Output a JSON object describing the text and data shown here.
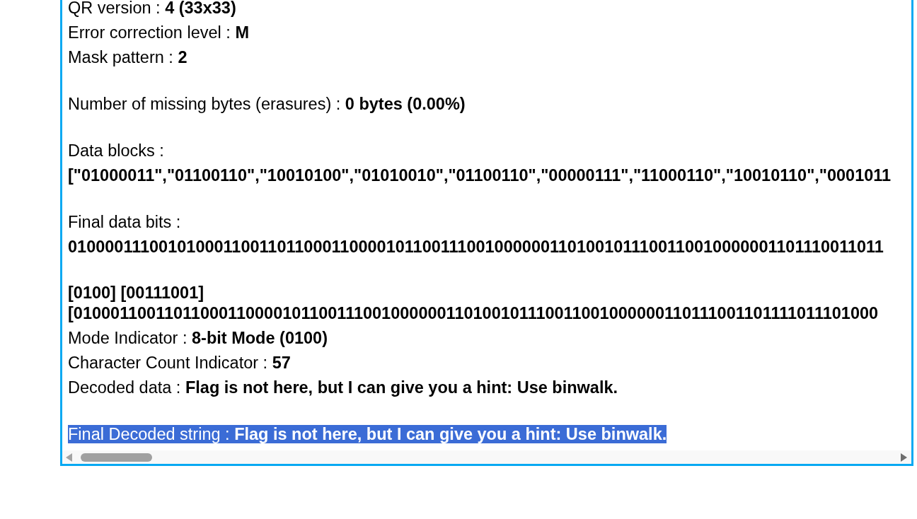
{
  "output_panel": {
    "sections": [
      {
        "lines": [
          {
            "kind": "field",
            "label": "QR version :",
            "value": "4 (33x33)",
            "highlighted": false
          },
          {
            "kind": "field",
            "label": "Error correction level :",
            "value": "M",
            "highlighted": false
          },
          {
            "kind": "field",
            "label": "Mask pattern :",
            "value": "2",
            "highlighted": false
          }
        ]
      },
      {
        "lines": [
          {
            "kind": "field",
            "label": "Number of missing bytes (erasures) :",
            "value": "0 bytes (0.00%)",
            "highlighted": false
          }
        ]
      },
      {
        "lines": [
          {
            "kind": "heading",
            "label": "Data blocks :",
            "highlighted": false
          },
          {
            "kind": "bits",
            "value": "[\"01000011\",\"01100110\",\"10010100\",\"01010010\",\"01100110\",\"00000111\",\"11000110\",\"10010110\",\"0001011",
            "highlighted": false
          }
        ]
      },
      {
        "lines": [
          {
            "kind": "heading",
            "label": "Final data bits :",
            "highlighted": false
          },
          {
            "kind": "bits",
            "value": "010000111001010001100110110001100001011001110010000001101001011100110010000001101110011011",
            "highlighted": false
          }
        ]
      },
      {
        "lines": [
          {
            "kind": "packed",
            "value": "[0100] [00111001]",
            "highlighted": false
          },
          {
            "kind": "packed",
            "value": "[01000110011011000110000101100111001000000110100101110011001000000110111001101111011101000",
            "highlighted": false
          },
          {
            "kind": "field",
            "label": "Mode Indicator :",
            "value": "8-bit Mode (0100)",
            "highlighted": false
          },
          {
            "kind": "field",
            "label": "Character Count Indicator :",
            "value": "57",
            "highlighted": false
          },
          {
            "kind": "field",
            "label": "Decoded data :",
            "value": "Flag is not here, but I can give you a hint: Use binwalk.",
            "highlighted": false
          }
        ]
      },
      {
        "lines": [
          {
            "kind": "field",
            "label": "Final Decoded string :",
            "value": "Flag is not here, but I can give you a hint: Use binwalk.",
            "highlighted": true
          }
        ]
      }
    ]
  }
}
